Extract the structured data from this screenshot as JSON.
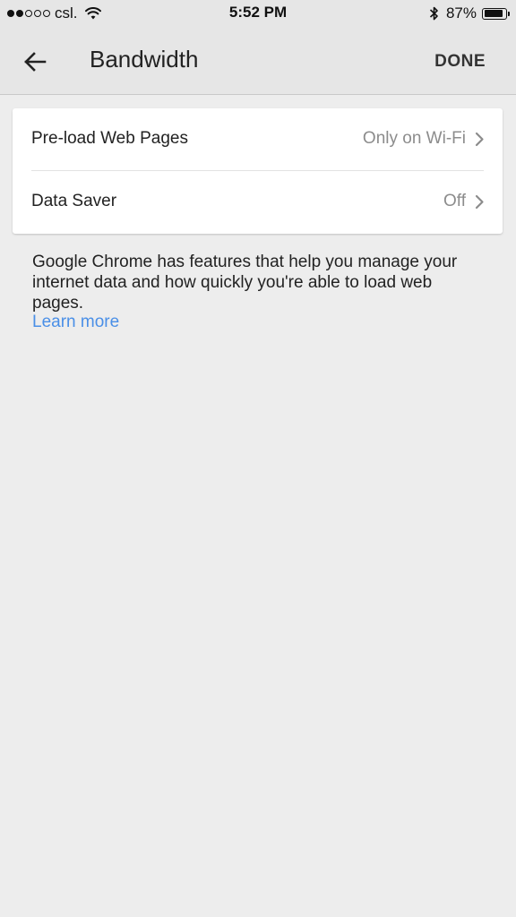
{
  "status_bar": {
    "carrier": "csl.",
    "time": "5:52 PM",
    "battery_percent": "87%",
    "battery_level": 0.87,
    "signal_bars_filled": 2,
    "signal_bars_total": 5
  },
  "header": {
    "title": "Bandwidth",
    "done_label": "DONE",
    "back_icon": "arrow-left-icon"
  },
  "settings": [
    {
      "label": "Pre-load Web Pages",
      "value": "Only on Wi-Fi"
    },
    {
      "label": "Data Saver",
      "value": "Off"
    }
  ],
  "description": {
    "text": "Google Chrome has features that help you manage your internet data and how quickly you're able to load web pages.",
    "link_label": "Learn more"
  },
  "colors": {
    "link": "#4a8fe7",
    "background": "#ededed",
    "header_background": "#e6e6e6",
    "secondary_text": "#8c8c8c"
  }
}
